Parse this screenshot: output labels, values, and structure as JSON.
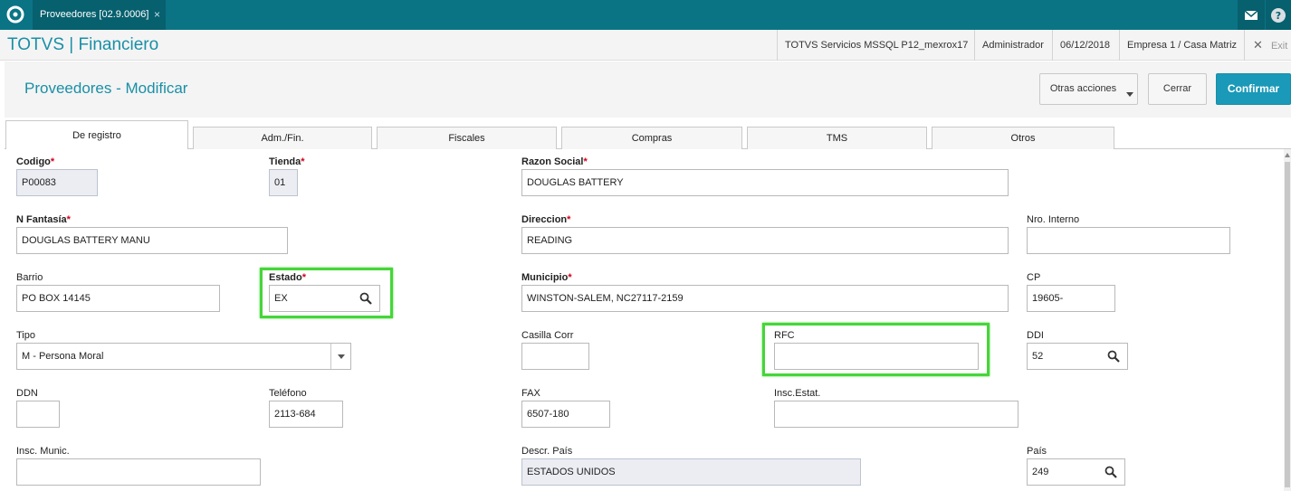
{
  "window_tab": {
    "label": "Proveedores [02.9.0006]",
    "close": "×"
  },
  "app": {
    "title": "TOTVS | Financiero",
    "server": "TOTVS Servicios MSSQL P12_mexrox17",
    "user": "Administrador",
    "date": "06/12/2018",
    "company": "Empresa 1 / Casa Matriz",
    "exit_label": "Exit",
    "exit_icon": "✕"
  },
  "header": {
    "title": "Proveedores - Modificar",
    "other_actions": "Otras acciones",
    "close": "Cerrar",
    "confirm": "Confirmar"
  },
  "tabs": [
    "De registro",
    "Adm./Fin.",
    "Fiscales",
    "Compras",
    "TMS",
    "Otros"
  ],
  "form": {
    "codigo": {
      "label": "Codigo",
      "req": "*",
      "value": "P00083"
    },
    "tienda": {
      "label": "Tienda",
      "req": "*",
      "value": "01"
    },
    "razon_social": {
      "label": "Razon Social",
      "req": "*",
      "value": "DOUGLAS BATTERY"
    },
    "n_fantasia": {
      "label": "N Fantasía",
      "req": "*",
      "value": "DOUGLAS BATTERY MANU"
    },
    "direccion": {
      "label": "Direccion",
      "req": "*",
      "value": "READING"
    },
    "nro_interno": {
      "label": "Nro. Interno",
      "value": ""
    },
    "barrio": {
      "label": "Barrio",
      "value": "PO BOX 14145"
    },
    "estado": {
      "label": "Estado",
      "req": "*",
      "value": "EX"
    },
    "municipio": {
      "label": "Municipio",
      "req": "*",
      "value": "WINSTON-SALEM, NC27117-2159"
    },
    "cp": {
      "label": "CP",
      "value": "19605-"
    },
    "tipo": {
      "label": "Tipo",
      "value": "M - Persona Moral"
    },
    "casilla_corr": {
      "label": "Casilla Corr",
      "value": ""
    },
    "rfc": {
      "label": "RFC",
      "value": ""
    },
    "ddi": {
      "label": "DDI",
      "value": "52"
    },
    "ddn": {
      "label": "DDN",
      "value": ""
    },
    "telefono": {
      "label": "Teléfono",
      "value": "2113-684"
    },
    "fax": {
      "label": "FAX",
      "value": "6507-180"
    },
    "insc_estat": {
      "label": "Insc.Estat.",
      "value": ""
    },
    "insc_munic": {
      "label": "Insc. Munic.",
      "value": ""
    },
    "descr_pais": {
      "label": "Descr. País",
      "value": "ESTADOS UNIDOS"
    },
    "pais": {
      "label": "País",
      "value": "249"
    }
  },
  "colors": {
    "topbar": "#0a7485",
    "accent": "#1a8fa6",
    "primary_button": "#1a99b8",
    "required": "#d0021b",
    "highlight": "#46d53a"
  }
}
